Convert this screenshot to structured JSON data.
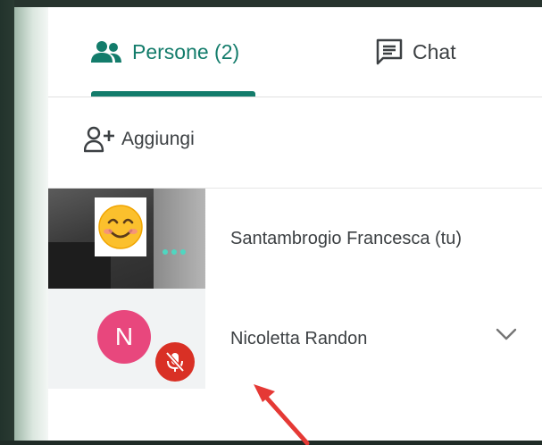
{
  "tabs": {
    "people_label": "Persone (2)",
    "chat_label": "Chat"
  },
  "actions": {
    "add_label": "Aggiungi"
  },
  "participants": [
    {
      "name": "Santambrogio Francesca (tu)",
      "emoji": "😊"
    },
    {
      "name": "Nicoletta Randon",
      "initial": "N",
      "muted": true
    }
  ],
  "colors": {
    "accent": "#137c6b",
    "avatar": "#e8477d",
    "mute": "#d93025",
    "arrow": "#e53935"
  }
}
